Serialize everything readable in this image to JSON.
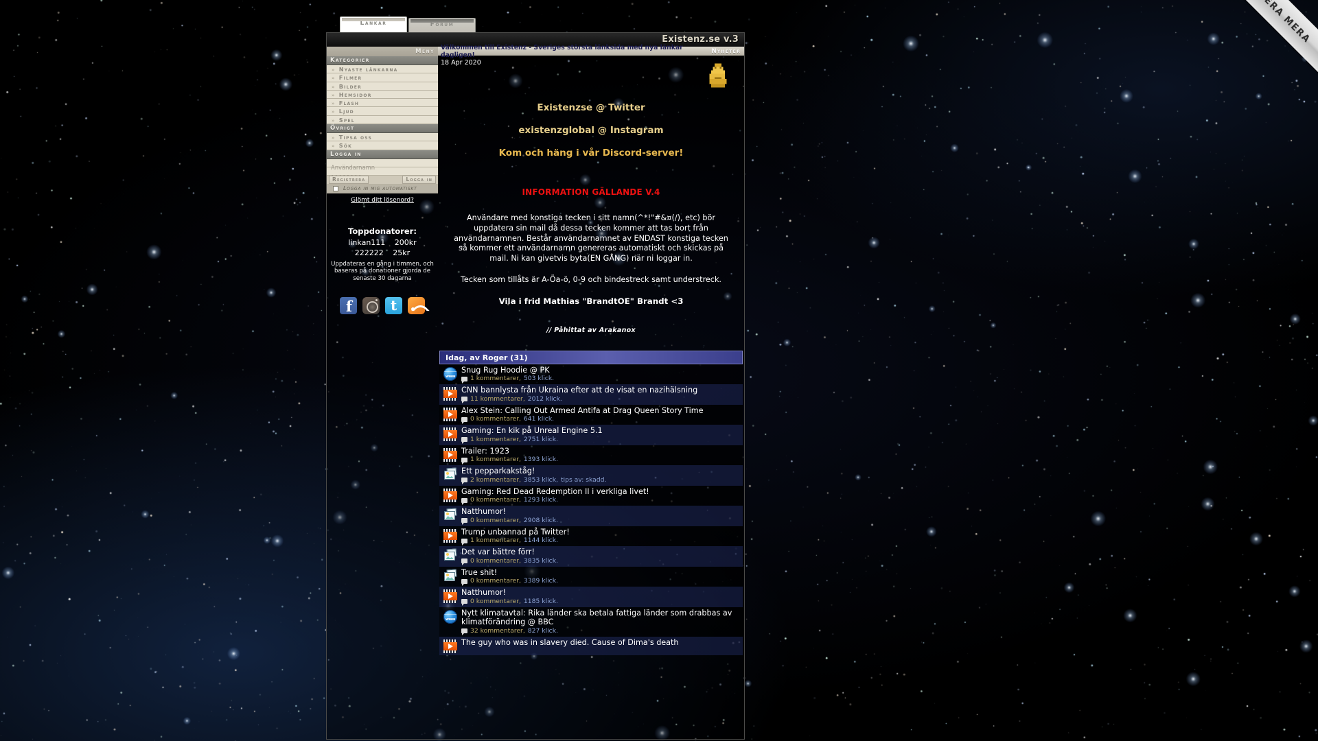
{
  "ribbon": {
    "label": "DONERA MERA"
  },
  "tabs": [
    {
      "label": "Länkar",
      "active": true
    },
    {
      "label": "Forum",
      "active": false
    }
  ],
  "header": {
    "site_title": "Existenz.se v.3"
  },
  "sidebar": {
    "menu_label": "Meny",
    "sections": [
      {
        "title": "Kategorier",
        "items": [
          "Nyaste länkarna",
          "Filmer",
          "Bilder",
          "Hemsidor",
          "Flash",
          "Ljud",
          "Spel"
        ]
      },
      {
        "title": "Övrigt",
        "items": [
          "Tipsa oss",
          "Sök"
        ]
      }
    ],
    "login": {
      "title": "Logga in",
      "username_value": "Användarnamn",
      "password_value": "••••••••",
      "register_label": "Registrera",
      "login_label": "Logga in",
      "auto_login_label": "Logga in mig automatiskt",
      "forgot_label": "Glömt ditt lösenord?"
    },
    "donors": {
      "title": "Toppdonatorer:",
      "rows": [
        {
          "name": "linkan111",
          "amount": "200kr"
        },
        {
          "name": "222222",
          "amount": "25kr"
        }
      ],
      "note": "Uppdateras en gång i timmen, och baseras på donationer gjorda de senaste 30 dagarna"
    },
    "social": [
      "facebook-icon",
      "instagram-icon",
      "twitter-icon",
      "rss-icon"
    ]
  },
  "main": {
    "welcome": "Välkommen till Existenz - Sveriges största länksida med nya länkar dagligen!",
    "news_label": "Nyheter",
    "date": "18 Apr 2020",
    "promos": [
      "Existenzse @ Twitter",
      "existenzglobal @ Instagram",
      "Kom och häng i vår Discord-server!"
    ],
    "info_heading": "INFORMATION GÄLLANDE V.4",
    "info_body": "Användare med konstiga tecken i sitt namn(^*!\"#&¤(/), etc) bör uppdatera sin mail då dessa tecken kommer att tas bort från användarnamnen. Består användarnamnet av ENDAST konstiga tecken så kommer ett användarnamn genereras automatiskt och skickas på mail. Ni kan givetvis byta(EN GÅNG) när ni loggar in.",
    "info_line": "Tecken som tillåts är A-Öa-ö, 0-9 och bindestreck samt understreck.",
    "vila": "Vila i frid Mathias \"BrandtOE\" Brandt <3",
    "byline": "// Påhittat av Arakanox"
  },
  "list": {
    "heading": "Idag, av Roger (31)",
    "items": [
      {
        "icon": "www",
        "title": "Snug Rug Hoodie @ PK",
        "comments": "1 kommentarer,",
        "clicks": "503 klick.",
        "tips": ""
      },
      {
        "icon": "video",
        "title": "CNN bannlysta från Ukraina efter att de visat en nazihälsning",
        "comments": "11 kommentarer,",
        "clicks": "2012 klick.",
        "tips": ""
      },
      {
        "icon": "video",
        "title": "Alex Stein: Calling Out Armed Antifa at Drag Queen Story Time",
        "comments": "0 kommentarer,",
        "clicks": "641 klick.",
        "tips": ""
      },
      {
        "icon": "video",
        "title": "Gaming: En kik på Unreal Engine 5.1",
        "comments": "1 kommentarer,",
        "clicks": "2751 klick.",
        "tips": ""
      },
      {
        "icon": "video",
        "title": "Trailer: 1923",
        "comments": "1 kommentarer,",
        "clicks": "1393 klick.",
        "tips": ""
      },
      {
        "icon": "img",
        "title": "Ett pepparkakståg!",
        "comments": "2 kommentarer,",
        "clicks": "3853 klick,",
        "tips": "tips av: skadd."
      },
      {
        "icon": "video",
        "title": "Gaming: Red Dead Redemption II i verkliga livet!",
        "comments": "0 kommentarer,",
        "clicks": "1293 klick.",
        "tips": ""
      },
      {
        "icon": "img",
        "title": "Natthumor!",
        "comments": "0 kommentarer,",
        "clicks": "2908 klick.",
        "tips": ""
      },
      {
        "icon": "video",
        "title": "Trump unbannad på Twitter!",
        "comments": "1 kommentarer,",
        "clicks": "1144 klick.",
        "tips": ""
      },
      {
        "icon": "img",
        "title": "Det var bättre förr!",
        "comments": "0 kommentarer,",
        "clicks": "3835 klick.",
        "tips": ""
      },
      {
        "icon": "img",
        "title": "True shit!",
        "comments": "0 kommentarer,",
        "clicks": "3389 klick.",
        "tips": ""
      },
      {
        "icon": "video",
        "title": "Natthumor!",
        "comments": "0 kommentarer,",
        "clicks": "1185 klick.",
        "tips": ""
      },
      {
        "icon": "www",
        "title": "Nytt klimatavtal: Rika länder ska betala fattiga länder som drabbas av klimatförändring @ BBC",
        "comments": "32 kommentarer,",
        "clicks": "827 klick.",
        "tips": ""
      },
      {
        "icon": "video",
        "title": "The guy who was in slavery died. Cause of Dima's death",
        "comments": "",
        "clicks": "",
        "tips": ""
      }
    ]
  }
}
